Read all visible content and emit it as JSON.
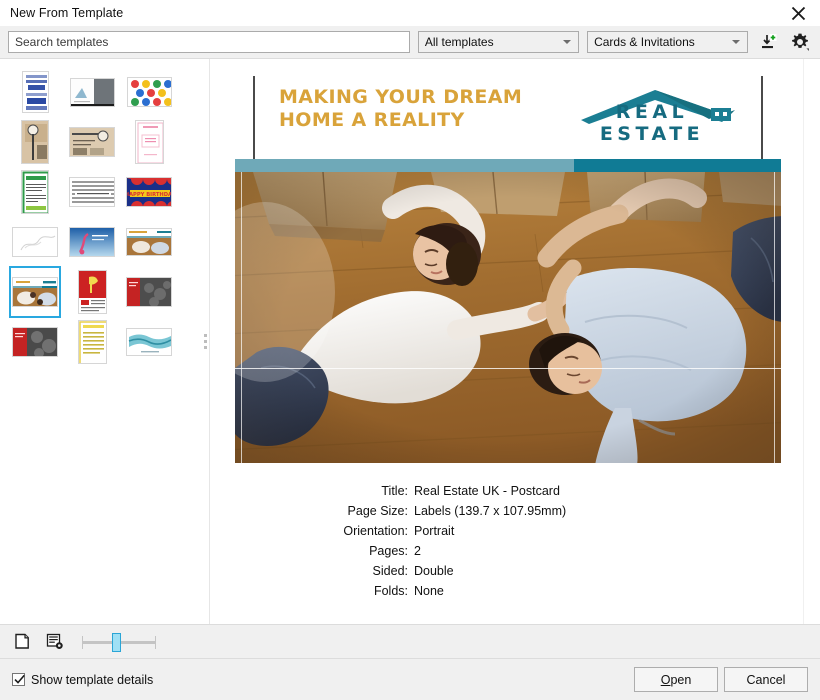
{
  "window": {
    "title": "New From Template",
    "close_label": "×"
  },
  "toolbar": {
    "search_placeholder": "Search templates",
    "search_value": "",
    "filter_all": "All templates",
    "filter_category": "Cards & Invitations",
    "import_icon": "import-template-icon",
    "settings_icon": "gear-icon"
  },
  "thumbnails": {
    "selected_index": 12,
    "items": [
      {
        "name": "blue-pattern-card",
        "orientation": "portrait"
      },
      {
        "name": "grey-photo-card",
        "orientation": "landscape"
      },
      {
        "name": "colorful-pattern-card",
        "orientation": "landscape"
      },
      {
        "name": "kraft-tag-card",
        "orientation": "portrait"
      },
      {
        "name": "kraft-banner-card",
        "orientation": "landscape"
      },
      {
        "name": "pink-invite-card",
        "orientation": "portrait"
      },
      {
        "name": "green-certificate-card",
        "orientation": "portrait"
      },
      {
        "name": "grey-text-card",
        "orientation": "landscape"
      },
      {
        "name": "happy-birthday-card",
        "orientation": "landscape"
      },
      {
        "name": "white-sketch-card",
        "orientation": "landscape"
      },
      {
        "name": "blue-sky-card",
        "orientation": "landscape"
      },
      {
        "name": "real-estate-wide-card",
        "orientation": "landscape"
      },
      {
        "name": "real-estate-uk-postcard",
        "orientation": "landscape"
      },
      {
        "name": "red-yellow-flyer-card",
        "orientation": "portrait"
      },
      {
        "name": "red-dark-photo-card",
        "orientation": "landscape"
      },
      {
        "name": "red-dark-photo-card-2",
        "orientation": "landscape"
      },
      {
        "name": "yellow-list-card",
        "orientation": "portrait"
      },
      {
        "name": "teal-landscape-card",
        "orientation": "landscape"
      }
    ]
  },
  "preview": {
    "artwork": {
      "tagline": "MAKING YOUR DREAM\nHOME A REALITY",
      "logo_text": "REAL ESTATE",
      "tagline_color": "#d9a33a",
      "logo_color": "#166b80",
      "bar_left_color": "#6fa9b8",
      "bar_right_color": "#107b95",
      "photo_alt": "couple lying on wooden floor surrounded by moving boxes"
    },
    "details": [
      {
        "label": "Title:",
        "value": "Real Estate UK - Postcard"
      },
      {
        "label": "Page Size:",
        "value": "Labels (139.7 x 107.95mm)"
      },
      {
        "label": "Orientation:",
        "value": "Portrait"
      },
      {
        "label": "Pages:",
        "value": "2"
      },
      {
        "label": "Sided:",
        "value": "Double"
      },
      {
        "label": "Folds:",
        "value": "None"
      }
    ]
  },
  "bottom_bar": {
    "new_page_icon": "new-page-icon",
    "page_settings_icon": "page-settings-icon",
    "zoom_value": "50"
  },
  "footer": {
    "show_details_label": "Show template details",
    "show_details_checked": true,
    "open_label": "Open",
    "open_accel": "O",
    "cancel_label": "Cancel"
  }
}
